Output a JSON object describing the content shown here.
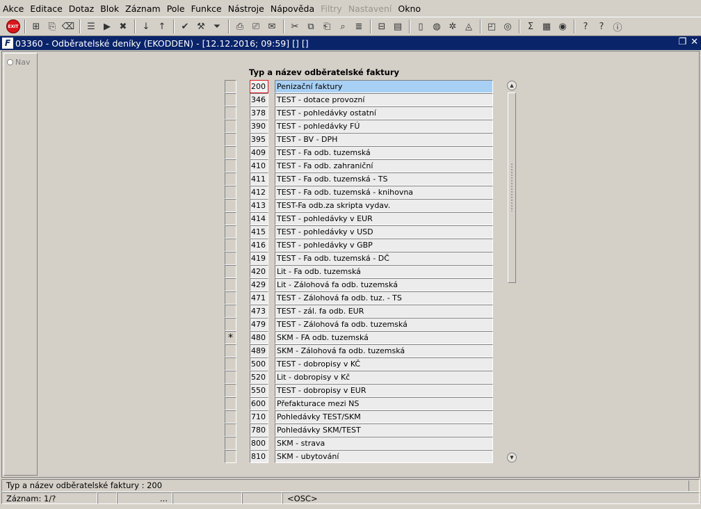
{
  "menu": [
    {
      "label": "Akce",
      "disabled": false
    },
    {
      "label": "Editace",
      "disabled": false
    },
    {
      "label": "Dotaz",
      "disabled": false
    },
    {
      "label": "Blok",
      "disabled": false
    },
    {
      "label": "Záznam",
      "disabled": false
    },
    {
      "label": "Pole",
      "disabled": false
    },
    {
      "label": "Funkce",
      "disabled": false
    },
    {
      "label": "Nástroje",
      "disabled": false
    },
    {
      "label": "Nápověda",
      "disabled": false
    },
    {
      "label": "Filtry",
      "disabled": true
    },
    {
      "label": "Nastavení",
      "disabled": true
    },
    {
      "label": "Okno",
      "disabled": false
    }
  ],
  "toolbar": {
    "exit_label": "EXIT",
    "buttons": [
      {
        "name": "insert-record-icon",
        "glyph": "⊞"
      },
      {
        "name": "duplicate-record-icon",
        "glyph": "⎘"
      },
      {
        "name": "delete-record-icon",
        "glyph": "⌫"
      },
      {
        "name": "query-enter-icon",
        "glyph": "☰"
      },
      {
        "name": "query-execute-icon",
        "glyph": "▶"
      },
      {
        "name": "query-cancel-icon",
        "glyph": "✖"
      },
      {
        "name": "sort-ascending-icon",
        "glyph": "↓"
      },
      {
        "name": "sort-descending-icon",
        "glyph": "↑"
      },
      {
        "name": "check-icon",
        "glyph": "✔"
      },
      {
        "name": "wrench-icon",
        "glyph": "⚒"
      },
      {
        "name": "filter-icon",
        "glyph": "⏷"
      },
      {
        "name": "print-icon",
        "glyph": "⎙"
      },
      {
        "name": "print-preview-icon",
        "glyph": "⎚"
      },
      {
        "name": "mail-icon",
        "glyph": "✉"
      },
      {
        "name": "cut-icon",
        "glyph": "✂"
      },
      {
        "name": "copy-icon",
        "glyph": "⧉"
      },
      {
        "name": "paste-icon",
        "glyph": "⎗"
      },
      {
        "name": "search-icon",
        "glyph": "⌕"
      },
      {
        "name": "list-icon",
        "glyph": "≣"
      },
      {
        "name": "tree-icon",
        "glyph": "⊟"
      },
      {
        "name": "clipboard-icon",
        "glyph": "▤"
      },
      {
        "name": "page-icon",
        "glyph": "▯"
      },
      {
        "name": "globe-icon",
        "glyph": "◍"
      },
      {
        "name": "gear-icon",
        "glyph": "✲"
      },
      {
        "name": "mountain-icon",
        "glyph": "◬"
      },
      {
        "name": "chart-icon",
        "glyph": "◰"
      },
      {
        "name": "disc-icon",
        "glyph": "◎"
      },
      {
        "name": "sum-icon",
        "glyph": "Σ"
      },
      {
        "name": "excel-icon",
        "glyph": "▦"
      },
      {
        "name": "browser-icon",
        "glyph": "◉"
      },
      {
        "name": "help-icon",
        "glyph": "?"
      },
      {
        "name": "context-help-icon",
        "glyph": "?"
      },
      {
        "name": "info-icon",
        "glyph": "ⓘ"
      }
    ]
  },
  "window": {
    "title": "03360 - Odběratelské deníky (EKODDEN) - [12.12.2016; 09:59]  []  []",
    "icon_letter": "F",
    "restore_glyph": "❐",
    "close_glyph": "✕"
  },
  "nav": {
    "label": "Nav"
  },
  "table": {
    "header": "Typ a název odběratelské faktury",
    "selected_index": 0,
    "rows": [
      {
        "mark": "",
        "code": "200",
        "name": "Penizační faktury"
      },
      {
        "mark": "",
        "code": "346",
        "name": "TEST - dotace provozní"
      },
      {
        "mark": "",
        "code": "378",
        "name": "TEST - pohledávky ostatní"
      },
      {
        "mark": "",
        "code": "390",
        "name": "TEST - pohledávky FÚ"
      },
      {
        "mark": "",
        "code": "395",
        "name": "TEST - BV - DPH"
      },
      {
        "mark": "",
        "code": "409",
        "name": "TEST - Fa odb. tuzemská"
      },
      {
        "mark": "",
        "code": "410",
        "name": "TEST - Fa odb. zahraniční"
      },
      {
        "mark": "",
        "code": "411",
        "name": "TEST - Fa odb. tuzemská - TS"
      },
      {
        "mark": "",
        "code": "412",
        "name": "TEST - Fa odb. tuzemská - knihovna"
      },
      {
        "mark": "",
        "code": "413",
        "name": "TEST-Fa odb.za skripta vydav."
      },
      {
        "mark": "",
        "code": "414",
        "name": "TEST - pohledávky v EUR"
      },
      {
        "mark": "",
        "code": "415",
        "name": "TEST - pohledávky v USD"
      },
      {
        "mark": "",
        "code": "416",
        "name": "TEST - pohledávky v GBP"
      },
      {
        "mark": "",
        "code": "419",
        "name": "TEST - Fa odb. tuzemská - DČ"
      },
      {
        "mark": "",
        "code": "420",
        "name": "Lit - Fa odb. tuzemská"
      },
      {
        "mark": "",
        "code": "429",
        "name": "Lit - Zálohová fa odb. tuzemská"
      },
      {
        "mark": "",
        "code": "471",
        "name": "TEST - Zálohová fa odb. tuz. - TS"
      },
      {
        "mark": "",
        "code": "473",
        "name": "TEST - zál. fa odb. EUR"
      },
      {
        "mark": "",
        "code": "479",
        "name": "TEST - Zálohová fa odb. tuzemská"
      },
      {
        "mark": "*",
        "code": "480",
        "name": "SKM - FA odb. tuzemská"
      },
      {
        "mark": "",
        "code": "489",
        "name": "SKM - Zálohová fa odb. tuzemská"
      },
      {
        "mark": "",
        "code": "500",
        "name": "TEST - dobropisy v KČ"
      },
      {
        "mark": "",
        "code": "520",
        "name": "Lit - dobropisy v Kč"
      },
      {
        "mark": "",
        "code": "550",
        "name": "TEST - dobropisy v EUR"
      },
      {
        "mark": "",
        "code": "600",
        "name": "Přefakturace mezi NS"
      },
      {
        "mark": "",
        "code": "710",
        "name": "Pohledávky TEST/SKM"
      },
      {
        "mark": "",
        "code": "780",
        "name": "Pohledávky SKM/TEST"
      },
      {
        "mark": "",
        "code": "800",
        "name": "SKM - strava"
      },
      {
        "mark": "",
        "code": "810",
        "name": "SKM - ubytování"
      }
    ]
  },
  "status": {
    "hint": "Typ a název odběratelské faktury : 200",
    "record": "Záznam: 1/?",
    "cell2": "",
    "cell3": "...",
    "cell4": "",
    "cell5": "",
    "osc": "<OSC>"
  },
  "colors": {
    "titlebar": "#0a246a",
    "selected_row": "#a8d0f5",
    "active_field_border": "#d81c1c",
    "exit_button": "#d8171d"
  }
}
